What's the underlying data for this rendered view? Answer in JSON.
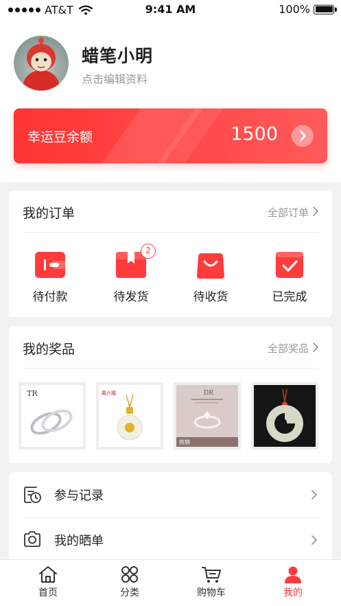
{
  "status_bar": {
    "carrier": "AT&T",
    "time": "9:41 AM",
    "battery": "100%"
  },
  "profile": {
    "name": "蜡笔小明",
    "subtitle": "点击编辑资料"
  },
  "beans": {
    "label": "幸运豆余额",
    "value": "1500"
  },
  "orders": {
    "title": "我的订单",
    "more": "全部订单",
    "items": [
      {
        "label": "待付款",
        "icon": "wallet-icon"
      },
      {
        "label": "待发货",
        "icon": "box-icon",
        "badge": "2"
      },
      {
        "label": "待收货",
        "icon": "shopping-bag-icon"
      },
      {
        "label": "已完成",
        "icon": "check-box-icon"
      }
    ]
  },
  "prizes": {
    "title": "我的奖品",
    "more": "全部奖品",
    "items": [
      {
        "icon": "ring-pair-image",
        "brand": "TR"
      },
      {
        "icon": "gold-pendant-image",
        "brand": "周六福"
      },
      {
        "icon": "diamond-ring-image",
        "brand": "DR",
        "tag": "热销"
      },
      {
        "icon": "jade-pendant-image"
      }
    ]
  },
  "menu": [
    {
      "label": "参与记录",
      "icon": "record-clock-icon"
    },
    {
      "label": "我的晒单",
      "icon": "camera-icon"
    }
  ],
  "tabbar": [
    {
      "label": "首页",
      "icon": "home-icon"
    },
    {
      "label": "分类",
      "icon": "category-icon"
    },
    {
      "label": "购物车",
      "icon": "cart-icon"
    },
    {
      "label": "我的",
      "icon": "user-icon",
      "active": true
    }
  ],
  "colors": {
    "accent": "#ff3b3b",
    "text": "#222222",
    "muted": "#999999",
    "background": "#f2f2f2"
  }
}
